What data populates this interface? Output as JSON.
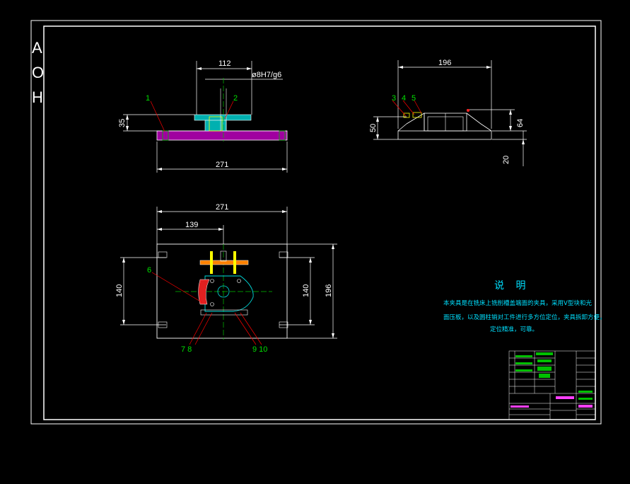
{
  "colors": {
    "background": "#000000",
    "frame": "#ffffff",
    "dimension": "#ffffff",
    "centerline": "#00c000",
    "part_fill": "#b000b0",
    "yellow_part": "#ffff00",
    "cyan_part": "#00e0e0",
    "red_part": "#ff2020",
    "leader": "#ff0000",
    "note_text": "#00e0ff"
  },
  "side_letters": [
    "A",
    "O",
    "H"
  ],
  "front_view": {
    "dims": {
      "width_top": "112",
      "fit": "ø8H7/g6",
      "height": "35",
      "base_width": "271"
    },
    "labels": [
      "1",
      "2"
    ]
  },
  "side_view": {
    "dims": {
      "width": "196",
      "height_left": "50",
      "height_right": "64",
      "base_thk": "20"
    },
    "labels": [
      "3",
      "4",
      "5"
    ]
  },
  "plan_view": {
    "dims": {
      "width": "271",
      "offset": "139",
      "slot_left": "140",
      "slot_right": "140",
      "depth": "196"
    },
    "labels": [
      "6",
      "7 8",
      "9 10"
    ]
  },
  "notes": {
    "title": "说  明",
    "lines": [
      "本夹具是在铣床上铣削槽盖端面的夹具，采用V型块和光",
      "面压板，以及圆柱销对工件进行多方位定位，夹具拆卸方便，",
      "定位精准，可靠。"
    ]
  }
}
